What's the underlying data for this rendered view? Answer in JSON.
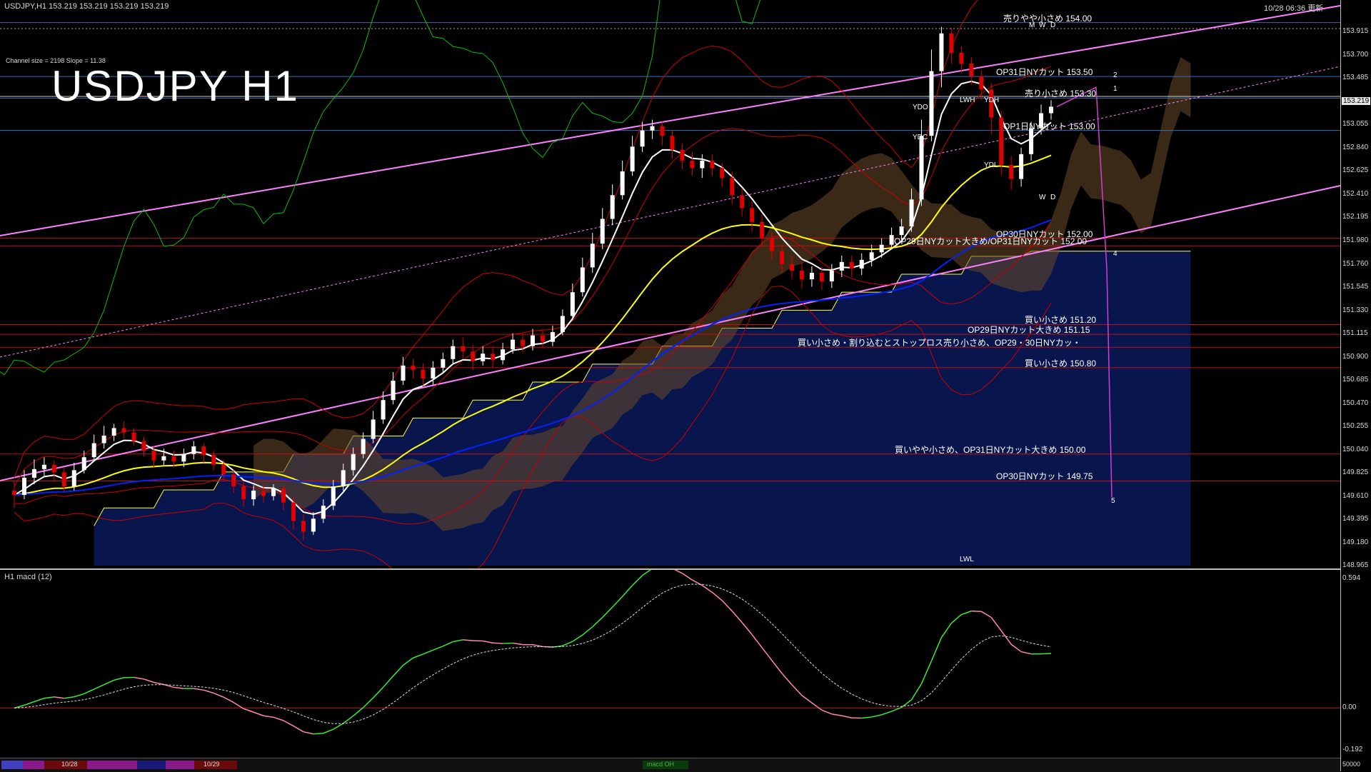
{
  "window": {
    "header": "USDJPY,H1  153.219 153.219 153.219 153.219",
    "timestamp": "10/28 06:36 更新",
    "channel_info": "Channel size = 2198 Slope = 11.38",
    "big_title": "USDJPY H1",
    "sub_header": "H1 macd (12)"
  },
  "levels": [
    {
      "text": "売りやや小さめ 154.00",
      "price": 154.0
    },
    {
      "text": "OP31日NYカット 153.50",
      "price": 153.5
    },
    {
      "text": "売り小さめ 153.30",
      "price": 153.3
    },
    {
      "text": "OP1日NYカット 153.00",
      "price": 153.0
    },
    {
      "text": "OP30日NYカット 152.00",
      "price": 152.0
    },
    {
      "text": "OP29日NYカット大きめ/OP31日NYカット 152.00",
      "price": 151.93
    },
    {
      "text": "買い小さめ 151.20",
      "price": 151.2
    },
    {
      "text": "OP29日NYカット大きめ 151.15",
      "price": 151.11
    },
    {
      "text": "買い小さめ・割り込むとストップロス売り小さめ、OP29・30日NYカッ・",
      "price": 150.99
    },
    {
      "text": "買い小さめ 150.80",
      "price": 150.8
    },
    {
      "text": "買いやや小さめ、OP31日NYカット大きめ 150.00",
      "price": 150.0
    },
    {
      "text": "OP30日NYカット 149.75",
      "price": 149.75
    }
  ],
  "box_labels": [
    "YDO",
    "YDC",
    "LWH",
    "YDH",
    "YDL",
    "LWL",
    "M",
    "W",
    "D",
    "W",
    "D"
  ],
  "wave_labels": [
    "1",
    "2",
    "4",
    "5"
  ],
  "price_axis": [
    "153.915",
    "153.700",
    "153.485",
    "153.270",
    "153.055",
    "152.840",
    "152.625",
    "152.410",
    "152.195",
    "151.980",
    "151.760",
    "151.545",
    "151.330",
    "151.115",
    "150.900",
    "150.685",
    "150.470",
    "150.255",
    "150.040",
    "149.825",
    "149.610",
    "149.395",
    "149.180",
    "148.965"
  ],
  "current_price": "153.219",
  "macd_axis": [
    "0.594",
    "0.00",
    "-0.192"
  ],
  "taskbar": {
    "labels": [
      "10/28",
      "10/29"
    ],
    "value": "50000",
    "tag": "macd OH"
  },
  "colors": {
    "bull": "#ffffff",
    "bear": "#e00000",
    "ema_white": "#ffffff",
    "ema_yellow": "#ffff00",
    "ema_blue": "#0022ff",
    "bollinger": "#cc0000",
    "chikou": "#00c000",
    "channel": "#ff80ff",
    "macd_up": "#33ee33",
    "macd_down": "#ff88aa"
  },
  "chart_data": {
    "type": "candlestick",
    "title": "USDJPY H1",
    "ylim": [
      148.965,
      154.13
    ],
    "candles": [
      [
        149.66,
        149.62,
        149.75,
        149.5
      ],
      [
        149.62,
        149.78,
        149.85,
        149.58
      ],
      [
        149.78,
        149.86,
        149.95,
        149.72
      ],
      [
        149.86,
        149.9,
        149.97,
        149.8
      ],
      [
        149.9,
        149.83,
        149.94,
        149.74
      ],
      [
        149.83,
        149.7,
        149.88,
        149.65
      ],
      [
        149.7,
        149.85,
        149.92,
        149.66
      ],
      [
        149.85,
        149.97,
        150.03,
        149.82
      ],
      [
        149.97,
        150.1,
        150.18,
        149.93
      ],
      [
        150.1,
        150.17,
        150.26,
        150.05
      ],
      [
        150.17,
        150.24,
        150.28,
        150.12
      ],
      [
        150.24,
        150.2,
        150.3,
        150.15
      ],
      [
        150.2,
        150.12,
        150.24,
        150.08
      ],
      [
        150.12,
        150.03,
        150.16,
        149.98
      ],
      [
        150.03,
        149.94,
        150.08,
        149.88
      ],
      [
        149.94,
        149.98,
        150.05,
        149.9
      ],
      [
        149.98,
        149.93,
        150.03,
        149.88
      ],
      [
        149.93,
        150.0,
        150.05,
        149.88
      ],
      [
        150.0,
        150.07,
        150.12,
        149.95
      ],
      [
        150.07,
        149.99,
        150.1,
        149.92
      ],
      [
        149.99,
        149.9,
        150.03,
        149.85
      ],
      [
        149.9,
        149.81,
        149.95,
        149.76
      ],
      [
        149.81,
        149.7,
        149.86,
        149.64
      ],
      [
        149.7,
        149.58,
        149.74,
        149.51
      ],
      [
        149.58,
        149.66,
        149.71,
        149.52
      ],
      [
        149.66,
        149.61,
        149.72,
        149.55
      ],
      [
        149.61,
        149.68,
        149.72,
        149.57
      ],
      [
        149.68,
        149.55,
        149.71,
        149.48
      ],
      [
        149.55,
        149.38,
        149.6,
        149.3
      ],
      [
        149.38,
        149.28,
        149.44,
        149.2
      ],
      [
        149.28,
        149.4,
        149.46,
        149.25
      ],
      [
        149.4,
        149.52,
        149.58,
        149.36
      ],
      [
        149.52,
        149.7,
        149.76,
        149.48
      ],
      [
        149.7,
        149.85,
        149.91,
        149.66
      ],
      [
        149.85,
        150.0,
        150.06,
        149.8
      ],
      [
        150.0,
        150.14,
        150.2,
        149.96
      ],
      [
        150.14,
        150.32,
        150.4,
        150.1
      ],
      [
        150.32,
        150.5,
        150.58,
        150.28
      ],
      [
        150.5,
        150.68,
        150.76,
        150.46
      ],
      [
        150.68,
        150.82,
        150.9,
        150.64
      ],
      [
        150.82,
        150.78,
        150.88,
        150.7
      ],
      [
        150.78,
        150.7,
        150.84,
        150.62
      ],
      [
        150.7,
        150.8,
        150.86,
        150.64
      ],
      [
        150.8,
        150.88,
        150.94,
        150.76
      ],
      [
        150.88,
        151.0,
        151.06,
        150.84
      ],
      [
        151.0,
        150.95,
        151.08,
        150.88
      ],
      [
        150.95,
        150.86,
        151.01,
        150.78
      ],
      [
        150.86,
        150.93,
        151.0,
        150.82
      ],
      [
        150.93,
        150.87,
        151.0,
        150.8
      ],
      [
        150.87,
        150.97,
        151.03,
        150.83
      ],
      [
        150.97,
        151.06,
        151.12,
        150.93
      ],
      [
        151.06,
        151.0,
        151.12,
        150.94
      ],
      [
        151.0,
        151.1,
        151.16,
        150.96
      ],
      [
        151.1,
        151.04,
        151.16,
        150.98
      ],
      [
        151.04,
        151.13,
        151.19,
        151.0
      ],
      [
        151.13,
        151.28,
        151.34,
        151.1
      ],
      [
        151.28,
        151.5,
        151.58,
        151.24
      ],
      [
        151.5,
        151.73,
        151.82,
        151.46
      ],
      [
        151.73,
        151.95,
        152.05,
        151.68
      ],
      [
        151.95,
        152.18,
        152.28,
        151.9
      ],
      [
        152.18,
        152.4,
        152.5,
        152.12
      ],
      [
        152.4,
        152.62,
        152.72,
        152.36
      ],
      [
        152.62,
        152.85,
        152.95,
        152.58
      ],
      [
        152.85,
        153.0,
        153.08,
        152.8
      ],
      [
        153.0,
        153.04,
        153.1,
        152.92
      ],
      [
        153.04,
        152.95,
        153.08,
        152.86
      ],
      [
        152.95,
        152.82,
        153.0,
        152.74
      ],
      [
        152.82,
        152.72,
        152.88,
        152.64
      ],
      [
        152.72,
        152.65,
        152.8,
        152.58
      ],
      [
        152.65,
        152.72,
        152.78,
        152.56
      ],
      [
        152.72,
        152.65,
        152.78,
        152.58
      ],
      [
        152.65,
        152.56,
        152.7,
        152.48
      ],
      [
        152.56,
        152.4,
        152.62,
        152.32
      ],
      [
        152.4,
        152.28,
        152.46,
        152.2
      ],
      [
        152.28,
        152.15,
        152.34,
        152.06
      ],
      [
        152.15,
        152.0,
        152.22,
        151.92
      ],
      [
        152.0,
        151.88,
        152.06,
        151.8
      ],
      [
        151.88,
        151.76,
        151.94,
        151.68
      ],
      [
        151.76,
        151.7,
        151.84,
        151.62
      ],
      [
        151.7,
        151.62,
        151.78,
        151.54
      ],
      [
        151.62,
        151.68,
        151.74,
        151.55
      ],
      [
        151.68,
        151.6,
        151.74,
        151.52
      ],
      [
        151.6,
        151.7,
        151.76,
        151.54
      ],
      [
        151.7,
        151.78,
        151.84,
        151.64
      ],
      [
        151.78,
        151.72,
        151.84,
        151.64
      ],
      [
        151.72,
        151.8,
        151.86,
        151.66
      ],
      [
        151.8,
        151.87,
        151.94,
        151.74
      ],
      [
        151.87,
        151.94,
        152.0,
        151.82
      ],
      [
        151.94,
        152.03,
        152.1,
        151.9
      ],
      [
        152.03,
        152.11,
        152.18,
        151.98
      ],
      [
        152.11,
        152.36,
        152.46,
        152.06
      ],
      [
        152.36,
        152.95,
        153.1,
        152.3
      ],
      [
        152.95,
        153.55,
        153.75,
        152.9
      ],
      [
        153.55,
        153.9,
        153.96,
        153.4
      ],
      [
        153.9,
        153.72,
        153.95,
        153.62
      ],
      [
        153.72,
        153.62,
        153.78,
        153.54
      ],
      [
        153.62,
        153.5,
        153.68,
        153.42
      ],
      [
        153.5,
        153.38,
        153.56,
        153.28
      ],
      [
        153.38,
        153.12,
        153.44,
        152.96
      ],
      [
        153.12,
        152.68,
        153.18,
        152.58
      ],
      [
        152.68,
        152.55,
        152.76,
        152.45
      ],
      [
        152.55,
        152.78,
        152.84,
        152.48
      ],
      [
        152.78,
        153.02,
        153.08,
        152.72
      ],
      [
        153.02,
        153.16,
        153.24,
        152.96
      ],
      [
        153.16,
        153.22,
        153.28,
        153.1
      ]
    ],
    "indicators": [
      "EMA white",
      "EMA yellow",
      "EMA blue",
      "Bollinger bands",
      "Ichimoku cloud",
      "Chikou span",
      "Channel lines"
    ]
  }
}
